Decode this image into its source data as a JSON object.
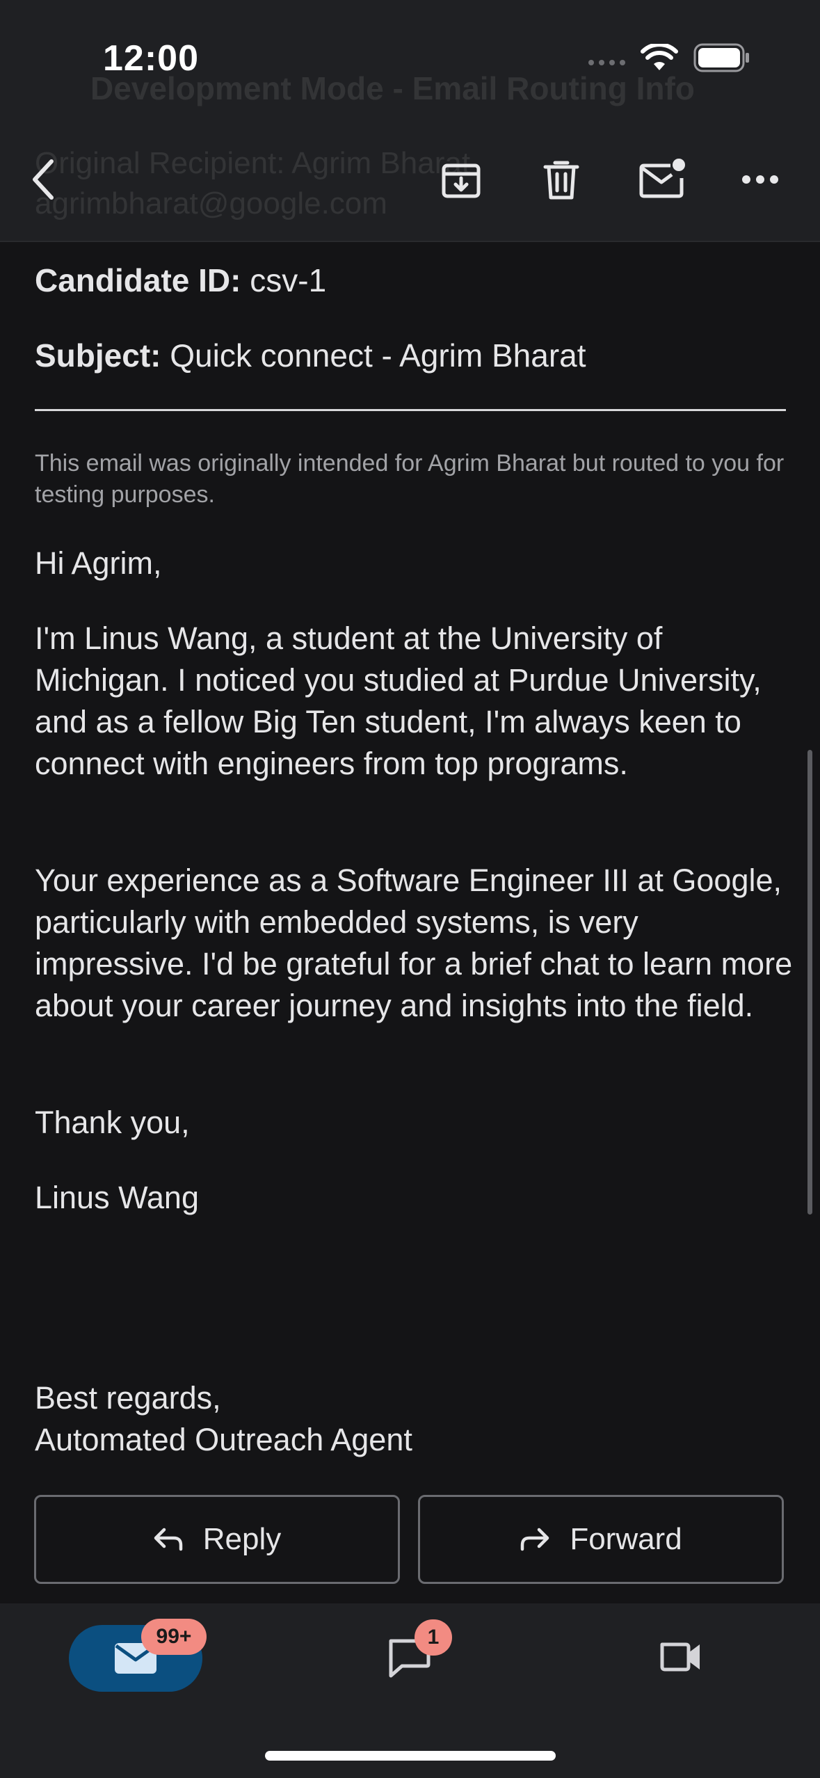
{
  "status_bar": {
    "time": "12:00"
  },
  "header": {
    "ghost_title": "Development Mode - Email Routing Info",
    "ghost_line1": "Original Recipient: Agrim Bharat",
    "ghost_line2": "agrimbharat@google.com",
    "toolbar_icons": [
      "back-arrow-icon",
      "archive-icon",
      "trash-icon",
      "mark-unread-icon",
      "more-options-icon"
    ]
  },
  "email": {
    "candidate_label": "Candidate ID:",
    "candidate_value": "csv-1",
    "subject_label": "Subject:",
    "subject_value": "Quick connect - Agrim Bharat",
    "routing_note": "This email was originally intended for Agrim Bharat but routed to you for testing purposes.",
    "greeting": "Hi Agrim,",
    "paragraph1": "I'm Linus Wang, a student at the University of Michigan. I noticed you studied at Purdue University, and as a fellow Big Ten student, I'm always keen to connect with engineers from top programs.",
    "paragraph2": "Your experience as a Software Engineer III at Google, particularly with embedded systems, is very impressive. I'd be grateful for a brief chat to learn more about your career journey and insights into the field.",
    "closing": "Thank you,",
    "signature": "Linus Wang",
    "sign_off": "Best regards,",
    "sign_off_name": "Automated Outreach Agent"
  },
  "actions": {
    "reply_label": "Reply",
    "forward_label": "Forward"
  },
  "tabbar": {
    "mail_badge": "99+",
    "chat_badge": "1"
  },
  "colors": {
    "background": "#141416",
    "header": "#1f2023",
    "mail_tab_active": "#0b4f80",
    "badge": "#f28b82"
  }
}
